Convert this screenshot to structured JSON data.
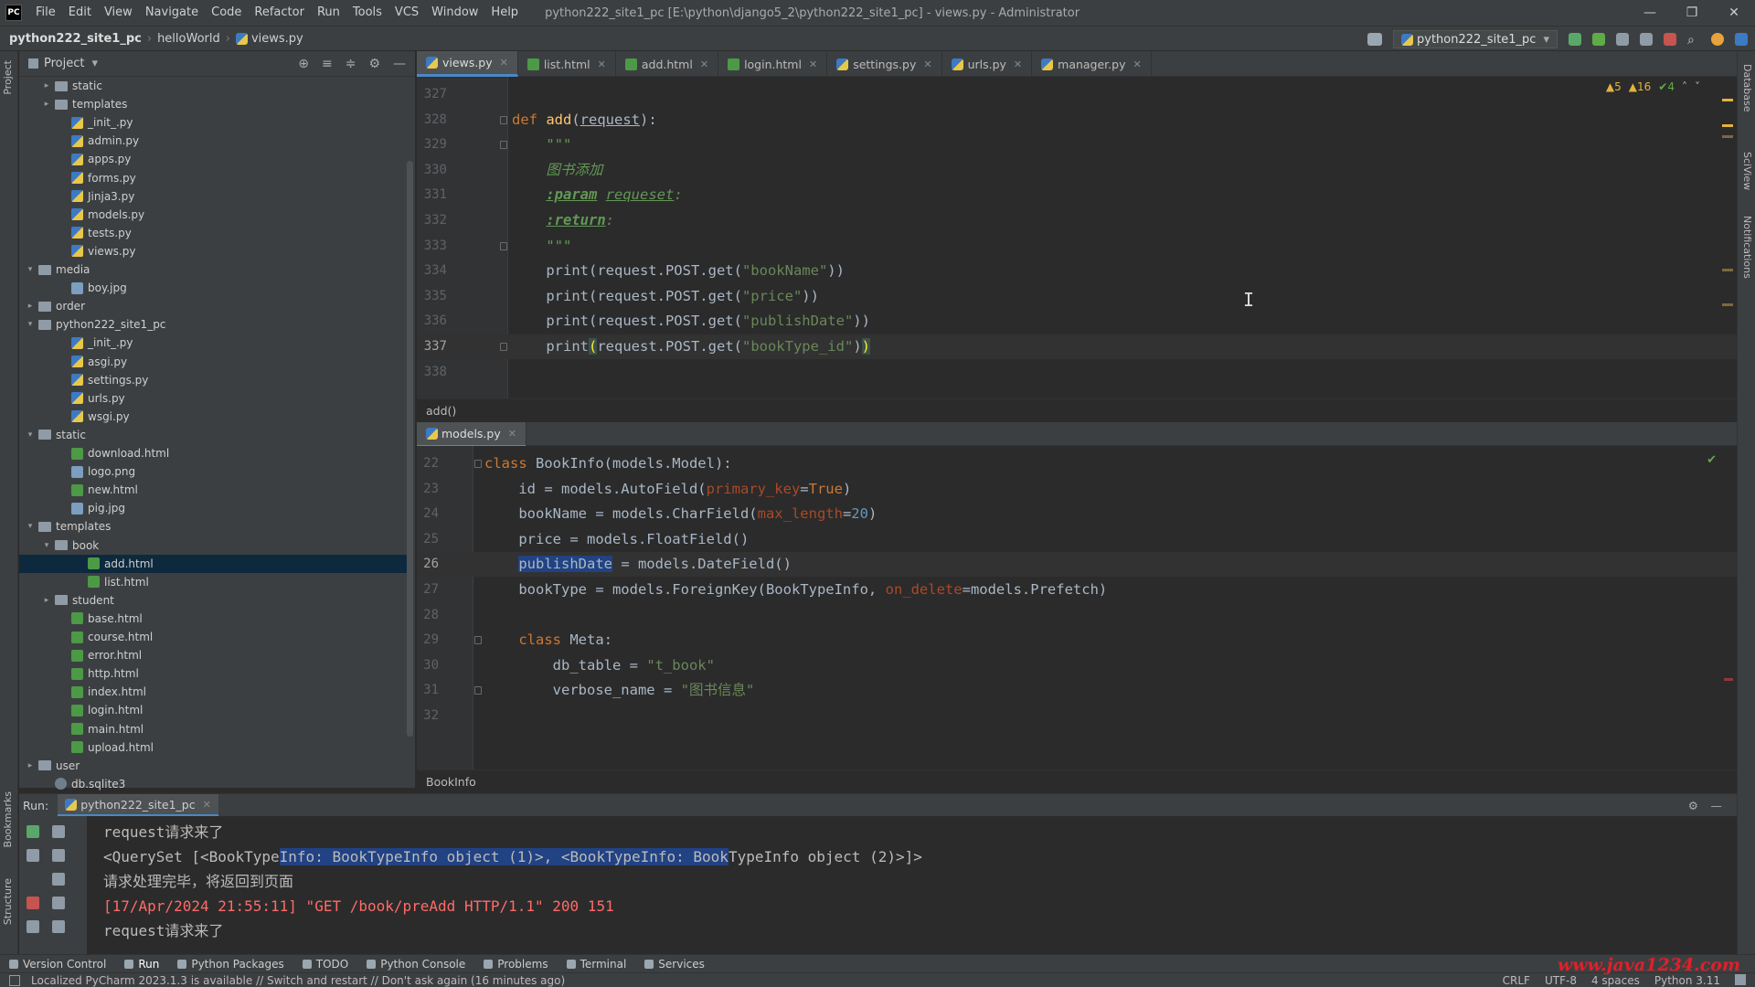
{
  "app": {
    "logo": "PC",
    "window_title": "python222_site1_pc [E:\\python\\django5_2\\python222_site1_pc] - views.py - Administrator"
  },
  "menu": [
    "File",
    "Edit",
    "View",
    "Navigate",
    "Code",
    "Refactor",
    "Run",
    "Tools",
    "VCS",
    "Window",
    "Help"
  ],
  "window_controls": {
    "minimize": "—",
    "maximize": "❐",
    "close": "✕"
  },
  "breadcrumb": {
    "project": "python222_site1_pc",
    "folder": "helloWorld",
    "file": "views.py"
  },
  "run_config": "python222_site1_pc",
  "left_stripe": {
    "project": "Project",
    "bookmarks": "Bookmarks",
    "structure": "Structure"
  },
  "right_stripe": {
    "database": "Database",
    "sciview": "SciView",
    "notifications": "Notifications"
  },
  "project_panel": {
    "title": "Project"
  },
  "tree": [
    {
      "label": "static",
      "type": "folder",
      "depth": 2,
      "arrow": "▸"
    },
    {
      "label": "templates",
      "type": "folder",
      "depth": 2,
      "arrow": "▸"
    },
    {
      "label": "_init_.py",
      "type": "py",
      "depth": 3
    },
    {
      "label": "admin.py",
      "type": "py",
      "depth": 3
    },
    {
      "label": "apps.py",
      "type": "py",
      "depth": 3
    },
    {
      "label": "forms.py",
      "type": "py",
      "depth": 3
    },
    {
      "label": "Jinja3.py",
      "type": "py",
      "depth": 3
    },
    {
      "label": "models.py",
      "type": "py",
      "depth": 3
    },
    {
      "label": "tests.py",
      "type": "py",
      "depth": 3
    },
    {
      "label": "views.py",
      "type": "py",
      "depth": 3
    },
    {
      "label": "media",
      "type": "folder",
      "depth": 1,
      "arrow": "▾"
    },
    {
      "label": "boy.jpg",
      "type": "img",
      "depth": 3
    },
    {
      "label": "order",
      "type": "folder",
      "depth": 1,
      "arrow": "▸"
    },
    {
      "label": "python222_site1_pc",
      "type": "folder",
      "depth": 1,
      "arrow": "▾"
    },
    {
      "label": "_init_.py",
      "type": "py",
      "depth": 3
    },
    {
      "label": "asgi.py",
      "type": "py",
      "depth": 3
    },
    {
      "label": "settings.py",
      "type": "py",
      "depth": 3
    },
    {
      "label": "urls.py",
      "type": "py",
      "depth": 3
    },
    {
      "label": "wsgi.py",
      "type": "py",
      "depth": 3
    },
    {
      "label": "static",
      "type": "folder",
      "depth": 1,
      "arrow": "▾"
    },
    {
      "label": "download.html",
      "type": "html",
      "depth": 3
    },
    {
      "label": "logo.png",
      "type": "img",
      "depth": 3
    },
    {
      "label": "new.html",
      "type": "html",
      "depth": 3
    },
    {
      "label": "pig.jpg",
      "type": "img",
      "depth": 3
    },
    {
      "label": "templates",
      "type": "folder",
      "depth": 1,
      "arrow": "▾"
    },
    {
      "label": "book",
      "type": "folder",
      "depth": 2,
      "arrow": "▾"
    },
    {
      "label": "add.html",
      "type": "html",
      "depth": 4,
      "selected": true
    },
    {
      "label": "list.html",
      "type": "html",
      "depth": 4
    },
    {
      "label": "student",
      "type": "folder",
      "depth": 2,
      "arrow": "▸"
    },
    {
      "label": "base.html",
      "type": "html",
      "depth": 3
    },
    {
      "label": "course.html",
      "type": "html",
      "depth": 3
    },
    {
      "label": "error.html",
      "type": "html",
      "depth": 3
    },
    {
      "label": "http.html",
      "type": "html",
      "depth": 3
    },
    {
      "label": "index.html",
      "type": "html",
      "depth": 3
    },
    {
      "label": "login.html",
      "type": "html",
      "depth": 3
    },
    {
      "label": "main.html",
      "type": "html",
      "depth": 3
    },
    {
      "label": "upload.html",
      "type": "html",
      "depth": 3
    },
    {
      "label": "user",
      "type": "folder",
      "depth": 1,
      "arrow": "▸"
    },
    {
      "label": "db.sqlite3",
      "type": "db",
      "depth": 2
    }
  ],
  "editor_tabs": [
    {
      "label": "views.py",
      "type": "py",
      "active": true
    },
    {
      "label": "list.html",
      "type": "html"
    },
    {
      "label": "add.html",
      "type": "html"
    },
    {
      "label": "login.html",
      "type": "html"
    },
    {
      "label": "settings.py",
      "type": "py"
    },
    {
      "label": "urls.py",
      "type": "py"
    },
    {
      "label": "manager.py",
      "type": "py"
    }
  ],
  "inspections": {
    "warnings": "▲5",
    "weak_warnings": "▲16",
    "ok": "✔4"
  },
  "top_code": [
    {
      "n": "327",
      "html": ""
    },
    {
      "n": "328",
      "html": "<span class='kw'>def </span><span class='fn'>add</span>(<u>request</u>):",
      "fold": true
    },
    {
      "n": "329",
      "html": "    <span class='doc'>\"\"\"</span>",
      "fold": true
    },
    {
      "n": "330",
      "html": "    <span class='doc'>图书添加</span>"
    },
    {
      "n": "331",
      "html": "    <span class='doc'><b><u>:param</u></b> <u>requeset</u>:</span>"
    },
    {
      "n": "332",
      "html": "    <span class='doc'><b><u>:return</u></b>:</span>"
    },
    {
      "n": "333",
      "html": "    <span class='doc'>\"\"\"</span>",
      "fold": true
    },
    {
      "n": "334",
      "html": "    print(request.POST.get(<span class='str'>\"bookName\"</span>))"
    },
    {
      "n": "335",
      "html": "    print(request.POST.get(<span class='str'>\"price\"</span>))"
    },
    {
      "n": "336",
      "html": "    print(request.POST.get(<span class='str'>\"publishDate\"</span>))"
    },
    {
      "n": "337",
      "html": "    print<span class='bracket-hl'>(</span>request.POST.get(<span class='str'>\"bookType_id\"</span>)<span class='bracket-hl'>)</span>",
      "fold": true,
      "current": true
    },
    {
      "n": "338",
      "html": ""
    }
  ],
  "top_crumb": "add()",
  "split_tab": "models.py",
  "bottom_code": [
    {
      "n": "22",
      "html": "<span class='kw'>class </span>BookInfo(models.Model):",
      "fold": true
    },
    {
      "n": "23",
      "html": "    id = models.AutoField(<span class='param'>primary_key</span>=<span class='kw'>True</span>)"
    },
    {
      "n": "24",
      "html": "    bookName = models.CharField(<span class='param'>max_length</span>=<span class='num'>20</span>)"
    },
    {
      "n": "25",
      "html": "    price = models.FloatField()"
    },
    {
      "n": "26",
      "html": "    <span class='hl'>publishDate</span> = models.DateField()",
      "current": true
    },
    {
      "n": "27",
      "html": "    bookType = models.ForeignKey(BookTypeInfo, <span class='param'>on_delete</span>=models.Prefetch)"
    },
    {
      "n": "28",
      "html": ""
    },
    {
      "n": "29",
      "html": "    <span class='kw'>class </span>Meta:",
      "fold": true
    },
    {
      "n": "30",
      "html": "        db_table = <span class='str'>\"t_book\"</span>"
    },
    {
      "n": "31",
      "html": "        verbose_name = <span class='str'>\"图书信息\"</span>",
      "fold": true
    },
    {
      "n": "32",
      "html": ""
    }
  ],
  "bottom_crumb": "BookInfo",
  "run_panel": {
    "label": "Run:",
    "tab": "python222_site1_pc"
  },
  "console": [
    {
      "cls": "normal",
      "text": "request请求来了"
    },
    {
      "cls": "normal",
      "pre": "<QuerySet [<BookType",
      "sel": "Info: BookTypeInfo object (1)>, <BookTypeInfo: Book",
      "post": "TypeInfo object (2)>]>"
    },
    {
      "cls": "normal",
      "text": "请求处理完毕，将返回到页面"
    },
    {
      "cls": "red",
      "text": "[17/Apr/2024 21:55:11] \"GET /book/preAdd HTTP/1.1\" 200 151"
    },
    {
      "cls": "normal",
      "text": "request请求来了"
    }
  ],
  "tool_windows": [
    {
      "label": "Version Control"
    },
    {
      "label": "Run",
      "active": true
    },
    {
      "label": "Python Packages"
    },
    {
      "label": "TODO"
    },
    {
      "label": "Python Console"
    },
    {
      "label": "Problems"
    },
    {
      "label": "Terminal"
    },
    {
      "label": "Services"
    }
  ],
  "status": {
    "message": "Localized PyCharm 2023.1.3 is available // Switch and restart // Don't ask again (16 minutes ago)",
    "line_sep": "CRLF",
    "encoding": "UTF-8",
    "indent": "4 spaces",
    "interpreter": "Python 3.11"
  },
  "watermark": "www.java1234.com"
}
